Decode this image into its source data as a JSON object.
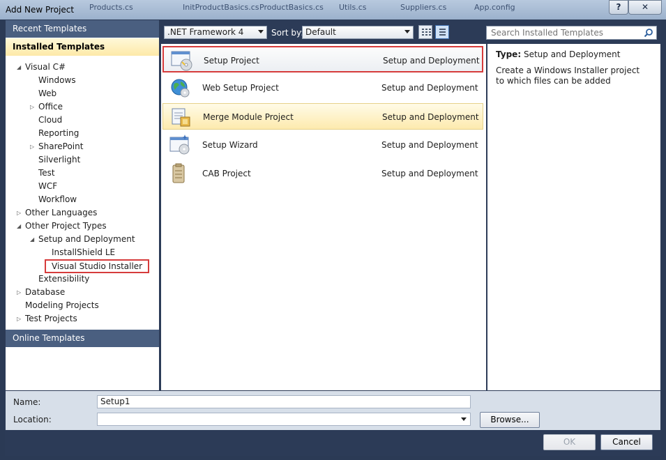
{
  "window": {
    "title": "Add New Project",
    "help_label": "?",
    "close_label": "✕",
    "background_tabs": [
      "Products.cs",
      "InitProductBasics.cs",
      "ProductBasics.cs",
      "Utils.cs",
      "Suppliers.cs",
      "App.config"
    ]
  },
  "sidebar": {
    "recent_templates": "Recent Templates",
    "installed_templates": "Installed Templates",
    "online_templates": "Online Templates",
    "tree": [
      {
        "label": "Visual C#",
        "arrow": "expanded"
      },
      {
        "label": "Windows",
        "arrow": "none"
      },
      {
        "label": "Web",
        "arrow": "none"
      },
      {
        "label": "Office",
        "arrow": "collapsed"
      },
      {
        "label": "Cloud",
        "arrow": "none"
      },
      {
        "label": "Reporting",
        "arrow": "none"
      },
      {
        "label": "SharePoint",
        "arrow": "collapsed"
      },
      {
        "label": "Silverlight",
        "arrow": "none"
      },
      {
        "label": "Test",
        "arrow": "none"
      },
      {
        "label": "WCF",
        "arrow": "none"
      },
      {
        "label": "Workflow",
        "arrow": "none"
      },
      {
        "label": "Other Languages",
        "arrow": "collapsed"
      },
      {
        "label": "Other Project Types",
        "arrow": "expanded"
      },
      {
        "label": "Setup and Deployment",
        "arrow": "expanded"
      },
      {
        "label": "InstallShield LE",
        "arrow": "none"
      },
      {
        "label": "Visual Studio Installer",
        "arrow": "none",
        "highlighted": true
      },
      {
        "label": "Extensibility",
        "arrow": "none"
      },
      {
        "label": "Database",
        "arrow": "collapsed"
      },
      {
        "label": "Modeling Projects",
        "arrow": "none"
      },
      {
        "label": "Test Projects",
        "arrow": "collapsed"
      }
    ]
  },
  "toolbar": {
    "framework": ".NET Framework 4",
    "sort_by_label": "Sort by:",
    "sort_value": "Default",
    "search_placeholder": "Search Installed Templates"
  },
  "templates": [
    {
      "name": "Setup Project",
      "category": "Setup and Deployment",
      "icon": "setup-project-icon",
      "state": "selected-boxed"
    },
    {
      "name": "Web Setup Project",
      "category": "Setup and Deployment",
      "icon": "web-setup-project-icon",
      "state": "normal"
    },
    {
      "name": "Merge Module Project",
      "category": "Setup and Deployment",
      "icon": "merge-module-icon",
      "state": "hover"
    },
    {
      "name": "Setup Wizard",
      "category": "Setup and Deployment",
      "icon": "setup-wizard-icon",
      "state": "normal"
    },
    {
      "name": "CAB Project",
      "category": "Setup and Deployment",
      "icon": "cab-project-icon",
      "state": "normal"
    }
  ],
  "description": {
    "type_label": "Type:",
    "type_value": "Setup and Deployment",
    "text": "Create a Windows Installer project to which files can be added"
  },
  "form": {
    "name_label": "Name:",
    "name_value": "Setup1",
    "location_label": "Location:",
    "location_value": "",
    "browse_label": "Browse...",
    "ok_label": "OK",
    "cancel_label": "Cancel"
  },
  "colors": {
    "panel_header": "#4a5f80",
    "installed_highlight": "#fde9a8",
    "selection_outline": "#d63b3b",
    "dialog_frame": "#2c3b57"
  }
}
